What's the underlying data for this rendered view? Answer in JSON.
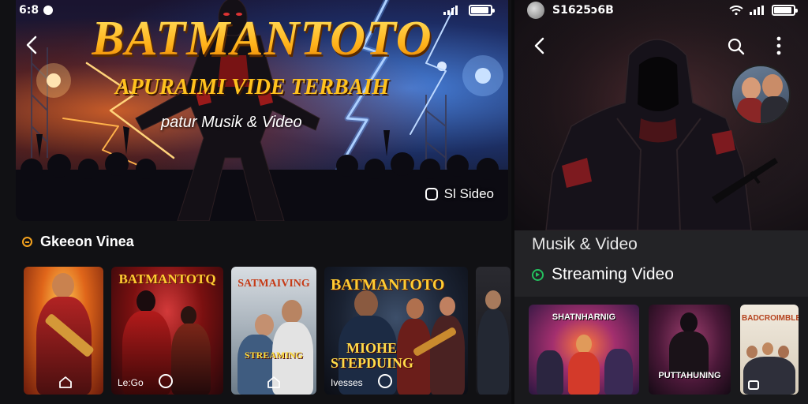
{
  "left_screen": {
    "status": {
      "time": "6:8",
      "battery_level": 0.85
    },
    "hero": {
      "title": "BATMANTOTO",
      "subtitle": "APURAIMI VIDE TERBAIH",
      "tagline": "patur Musik & Video",
      "video_label": "Sl Sideo"
    },
    "section": {
      "title": "Gkeeon Vinea",
      "accent_color": "#f4a21e"
    },
    "posters": [
      {
        "title": "",
        "banner": "",
        "bottom_label": ""
      },
      {
        "title": "BATMANTOTQ",
        "banner": "",
        "bottom_label": "Le:Go"
      },
      {
        "title": "SATMAIVING",
        "banner": "STREAMING",
        "bottom_label": ""
      },
      {
        "title": "BATMANTOTO",
        "banner": "MIOHE STEPDUING",
        "bottom_label": "Ivesses"
      },
      {
        "title": "",
        "banner": "",
        "bottom_label": ""
      }
    ]
  },
  "right_screen": {
    "status": {
      "carrier": "S1625ɔ6B",
      "battery_level": 0.85
    },
    "label": "Musik & Video",
    "streaming_label": "Streaming Video",
    "accent_color": "#24c05e",
    "posters": [
      {
        "title": "SHATNHARNIG"
      },
      {
        "title": "PUTTAHUNING"
      },
      {
        "title": "BADCROIMBLE"
      }
    ]
  }
}
